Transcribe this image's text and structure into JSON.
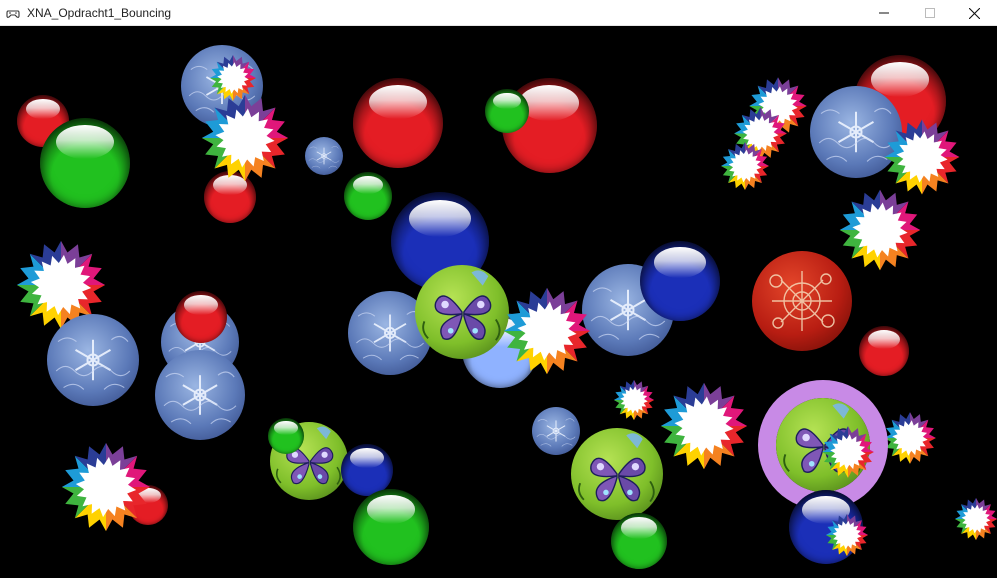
{
  "window": {
    "title": "XNA_Opdracht1_Bouncing",
    "icons": {
      "app": "gamepad-icon",
      "minimize": "minimize-icon",
      "maximize": "maximize-icon",
      "close": "close-icon"
    }
  },
  "scene": {
    "background": "#000000",
    "sprite_types": [
      "red-ball",
      "green-ball",
      "blue-ball",
      "snowflake-ornament",
      "butterfly-ornament",
      "red-ornament",
      "rainbow-star"
    ],
    "colors": {
      "red": "#e41d24",
      "green": "#21c11f",
      "blue": "#1b2fb8",
      "ornament_blue": "#5b79b8",
      "butterfly_green": "#7fbf2a",
      "purple_glow": "#c88ae6"
    }
  }
}
